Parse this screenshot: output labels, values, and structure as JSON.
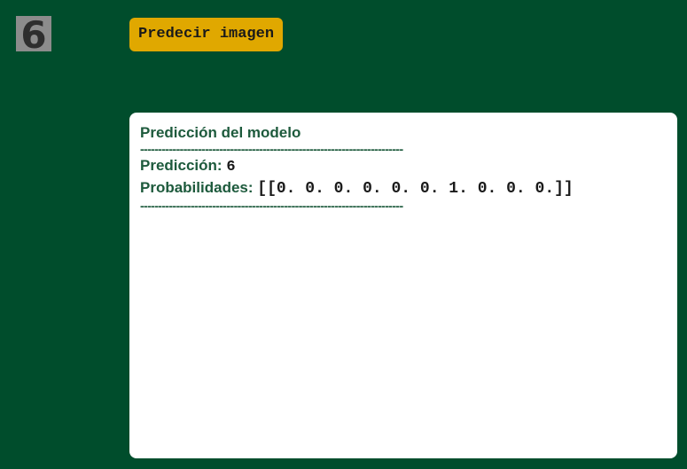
{
  "thumbnail": {
    "digit": "6"
  },
  "toolbar": {
    "predict_label": "Predecir imagen"
  },
  "result": {
    "title": "Predicción del modelo",
    "divider": "-------------------------------------------------------------------------",
    "prediction_label": "Predicción:",
    "prediction_value": "6",
    "probabilities_label": "Probabilidades:",
    "probabilities_value": "[[0. 0. 0. 0. 0. 0. 1. 0. 0. 0.]]"
  },
  "colors": {
    "background": "#004d2c",
    "button": "#e0a800",
    "panel": "#ffffff",
    "label_text": "#1d5a3c"
  }
}
